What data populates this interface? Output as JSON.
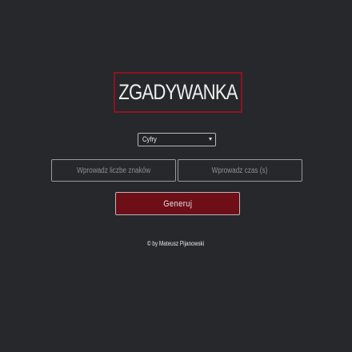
{
  "app": {
    "title": "ZGADYWANKA"
  },
  "form": {
    "mode_select": {
      "selected": "Cyfry"
    },
    "chars_input": {
      "value": "",
      "placeholder": "Wprowadz liczbe znaków"
    },
    "time_input": {
      "value": "",
      "placeholder": "Wprowadz czas (s)"
    },
    "generate_label": "Generuj"
  },
  "footer": {
    "text": "© by Mateusz Pijanowski"
  },
  "colors": {
    "background": "#26282b",
    "accent": "#8c1420",
    "button": "#6e0e17"
  }
}
